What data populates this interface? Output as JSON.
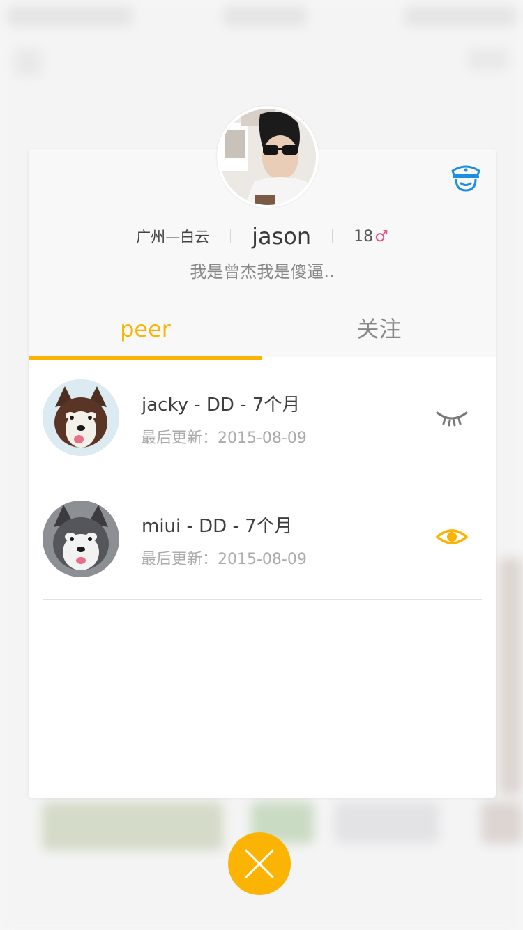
{
  "colors": {
    "accent": "#fbb404",
    "gender_male": "#e8508a",
    "badge": "#1a8fdf"
  },
  "profile": {
    "location": "广州—白云",
    "name": "jason",
    "age": "18",
    "gender_symbol": "♂",
    "bio": "我是曾杰我是傻逼..",
    "badge_icon": "police-cap-icon"
  },
  "tabs": [
    {
      "label": "peer",
      "active": true
    },
    {
      "label": "关注",
      "active": false
    }
  ],
  "pets": [
    {
      "title": "jacky - DD - 7个月",
      "updated": "最后更新：2015-08-09",
      "watch_icon": "eye-closed-icon"
    },
    {
      "title": "miui - DD - 7个月",
      "updated": "最后更新：2015-08-09",
      "watch_icon": "eye-open-icon"
    }
  ],
  "close": {
    "icon": "close-icon"
  }
}
